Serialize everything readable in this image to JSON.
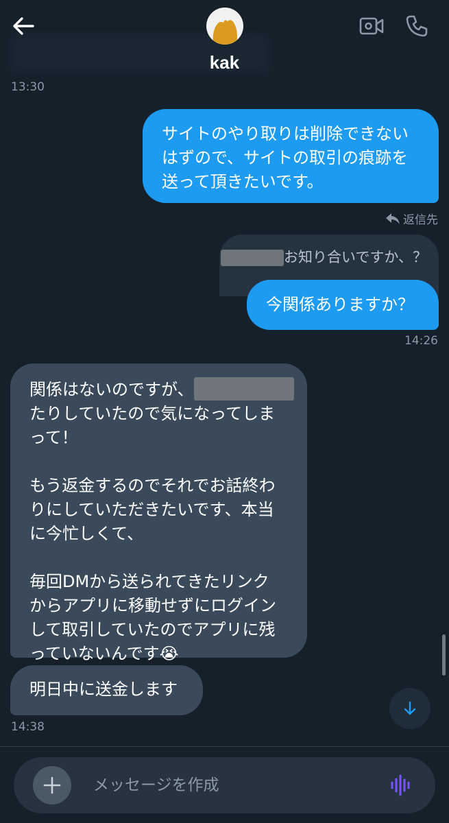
{
  "header": {
    "username": "kak",
    "back_icon": "back-arrow-icon",
    "video_icon": "video-call-icon",
    "call_icon": "phone-call-icon"
  },
  "messages": {
    "time_top": "13:30",
    "out1": {
      "lines": [
        "サイトのやり取りは削除できない",
        "はずので、サイトの取引の痕跡を",
        "送って頂きたいです。"
      ]
    },
    "reply_label": "返信先",
    "quote_text": "お知り合いですか、？",
    "out2": {
      "text": "今関係ありますか？",
      "time": "14:26"
    },
    "in1": {
      "line1": "関係はないのですが、",
      "lines_a": [
        "たりしていたので気になってしま",
        "って！"
      ],
      "lines_b": [
        "もう返金するのでそれでお話終わ",
        "りにしていただきたいです、本当",
        "に今忙しくて、"
      ],
      "lines_c": [
        "毎回DMから送られてきたリンク",
        "からアプリに移動せずにログイン",
        "して取引していたのでアプリに残"
      ],
      "last_line": "っていないんです",
      "emoji": "😭"
    },
    "in2": {
      "text": "明日中に送金します",
      "time": "14:38"
    }
  },
  "composer": {
    "placeholder": "メッセージを作成",
    "plus_icon": "plus-icon",
    "voice_icon": "voice-waveform-icon"
  },
  "colors": {
    "background": "#15202b",
    "outgoing_bubble": "#1d9bf0",
    "incoming_bubble": "#3a4a5a",
    "voice_accent": "#7856ff"
  }
}
